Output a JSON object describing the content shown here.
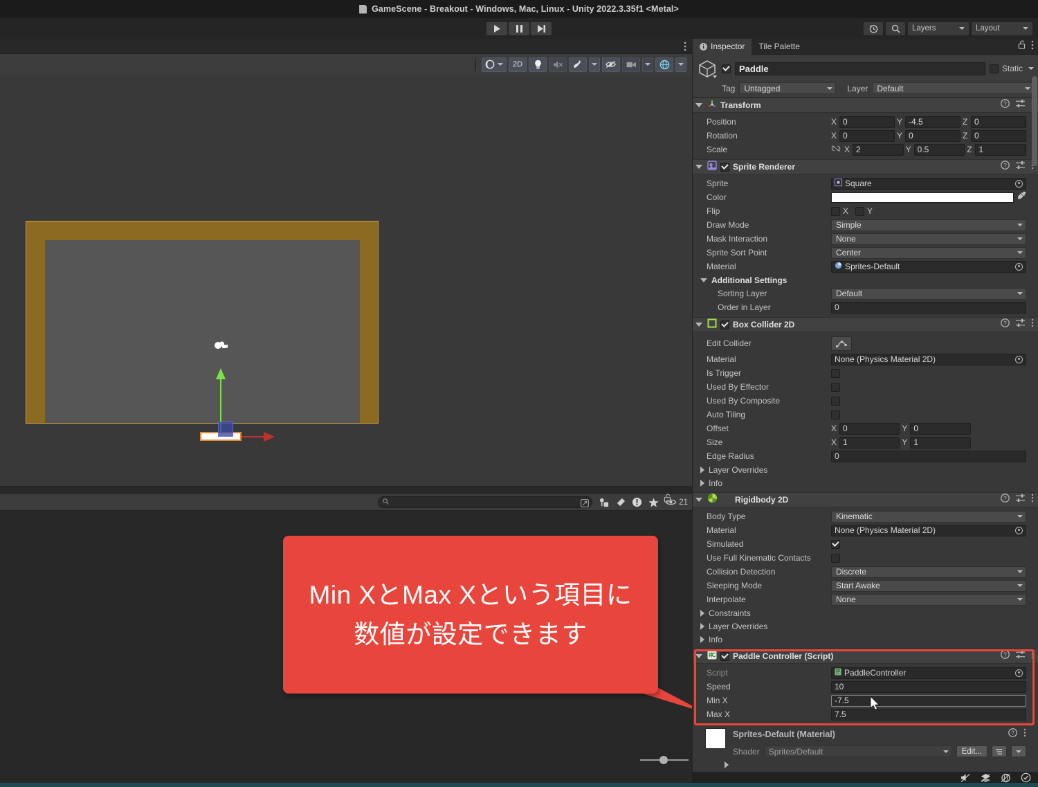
{
  "window": {
    "title": "GameScene - Breakout - Windows, Mac, Linux - Unity 2022.3.35f1 <Metal>",
    "doc_icon": "scene-file-icon"
  },
  "toolbar": {
    "play_icon": "play-icon",
    "pause_icon": "pause-icon",
    "step_icon": "step-icon",
    "history_icon": "undo-history-icon",
    "search_icon": "search-icon",
    "layers_label": "Layers",
    "layout_label": "Layout"
  },
  "scene_toolbar": {
    "buttons": [
      {
        "name": "scene-shading-mode",
        "label": "",
        "icon": "sphere-shading-icon",
        "has_caret": true
      },
      {
        "name": "scene-2d-toggle",
        "label": "2D",
        "icon": "",
        "has_caret": false
      },
      {
        "name": "scene-lighting-toggle",
        "label": "",
        "icon": "lightbulb-icon",
        "has_caret": false
      },
      {
        "name": "scene-audio-toggle",
        "label": "",
        "icon": "speaker-muted-icon",
        "has_caret": false
      },
      {
        "name": "scene-fx-toggle",
        "label": "",
        "icon": "effects-icon",
        "has_caret": true
      },
      {
        "name": "scene-hidden-objects",
        "label": "",
        "icon": "eye-slash-icon",
        "has_caret": false
      },
      {
        "name": "scene-camera-settings",
        "label": "",
        "icon": "camera-icon",
        "has_caret": true
      },
      {
        "name": "scene-gizmos-toggle",
        "label": "",
        "icon": "gizmo-globe-icon",
        "has_caret": true
      }
    ]
  },
  "scene": {
    "play_area_border_color": "#8b6a21",
    "paddle_color": "#ffffff",
    "paddle_outline_color": "#e08a3c",
    "gizmo_y_color": "#7ee04a",
    "gizmo_x_color": "#c0322b",
    "camera_icon": "camera-gizmo-icon"
  },
  "game_panel": {
    "search_placeholder": "",
    "toolbar_icons": [
      {
        "name": "grid-snap-icon"
      },
      {
        "name": "tool-settings-icon"
      },
      {
        "name": "gizmo-eraser-icon"
      },
      {
        "name": "info-icon"
      },
      {
        "name": "favorite-star-icon"
      }
    ],
    "visible_count": "21",
    "lock_icon": "lock-open-icon",
    "kebab_icon": "more-options-icon"
  },
  "callout": {
    "line1": "Min XとMax Xという項目に",
    "line2": "数値が設定できます",
    "background": "#e8453c",
    "text_color": "#ffffff"
  },
  "inspector": {
    "tabs": [
      {
        "label": "Inspector",
        "active": true,
        "icon": "info-icon"
      },
      {
        "label": "Tile Palette",
        "active": false,
        "icon": ""
      }
    ],
    "lock_icon": "lock-open-icon",
    "kebab_icon": "more-options-icon",
    "object": {
      "enabled": true,
      "name": "Paddle",
      "static_label": "Static",
      "static_checked": false,
      "tag_label": "Tag",
      "tag_value": "Untagged",
      "layer_label": "Layer",
      "layer_value": "Default",
      "prefab_icon": "gameobject-cube-icon"
    },
    "components": [
      {
        "id": "transform",
        "title": "Transform",
        "icon": "transform-axis-icon",
        "has_checkbox": false,
        "expanded": true,
        "help_icon": "help-icon",
        "preset_icon": "preset-icon",
        "kebab_icon": "more-options-icon",
        "rows": [
          {
            "type": "vector3",
            "label": "Position",
            "x": "0",
            "y": "-4.5",
            "z": "0",
            "link_icon": null
          },
          {
            "type": "vector3",
            "label": "Rotation",
            "x": "0",
            "y": "0",
            "z": "0",
            "link_icon": null
          },
          {
            "type": "vector3",
            "label": "Scale",
            "x": "2",
            "y": "0.5",
            "z": "1",
            "link_icon": "link-broken-icon"
          }
        ]
      },
      {
        "id": "sprite-renderer",
        "title": "Sprite Renderer",
        "icon": "sprite-renderer-icon",
        "has_checkbox": true,
        "checked": true,
        "expanded": true,
        "rows": [
          {
            "type": "object",
            "label": "Sprite",
            "value": "Square",
            "badge": "sprite-icon"
          },
          {
            "type": "color",
            "label": "Color",
            "value": "#ffffff",
            "picker_icon": "eyedropper-icon"
          },
          {
            "type": "flip",
            "label": "Flip",
            "x_label": "X",
            "y_label": "Y",
            "x_checked": false,
            "y_checked": false
          },
          {
            "type": "dropdown",
            "label": "Draw Mode",
            "value": "Simple"
          },
          {
            "type": "dropdown",
            "label": "Mask Interaction",
            "value": "None"
          },
          {
            "type": "dropdown",
            "label": "Sprite Sort Point",
            "value": "Center"
          },
          {
            "type": "object",
            "label": "Material",
            "value": "Sprites-Default",
            "badge": "material-sphere-icon"
          },
          {
            "type": "subheader",
            "label": "Additional Settings"
          },
          {
            "type": "dropdown",
            "label": "Sorting Layer",
            "value": "Default",
            "indent": true
          },
          {
            "type": "text",
            "label": "Order in Layer",
            "value": "0",
            "indent": true
          }
        ]
      },
      {
        "id": "box-collider-2d",
        "title": "Box Collider 2D",
        "icon": "box-collider-icon",
        "has_checkbox": true,
        "checked": true,
        "expanded": true,
        "rows": [
          {
            "type": "button",
            "label": "Edit Collider",
            "button_icon": "edit-collider-icon"
          },
          {
            "type": "object",
            "label": "Material",
            "value": "None (Physics Material 2D)",
            "badge": null
          },
          {
            "type": "checkbox",
            "label": "Is Trigger",
            "checked": false
          },
          {
            "type": "checkbox",
            "label": "Used By Effector",
            "checked": false
          },
          {
            "type": "checkbox",
            "label": "Used By Composite",
            "checked": false
          },
          {
            "type": "checkbox",
            "label": "Auto Tiling",
            "checked": false
          },
          {
            "type": "vector2",
            "label": "Offset",
            "x": "0",
            "y": "0"
          },
          {
            "type": "vector2",
            "label": "Size",
            "x": "1",
            "y": "1"
          },
          {
            "type": "text",
            "label": "Edge Radius",
            "value": "0"
          },
          {
            "type": "foldout",
            "label": "Layer Overrides"
          },
          {
            "type": "foldout",
            "label": "Info"
          }
        ]
      },
      {
        "id": "rigidbody-2d",
        "title": "Rigidbody 2D",
        "icon": "rigidbody-icon",
        "has_checkbox": false,
        "expanded": true,
        "rows": [
          {
            "type": "dropdown",
            "label": "Body Type",
            "value": "Kinematic"
          },
          {
            "type": "object",
            "label": "Material",
            "value": "None (Physics Material 2D)",
            "badge": null
          },
          {
            "type": "checkbox",
            "label": "Simulated",
            "checked": true
          },
          {
            "type": "checkbox",
            "label": "Use Full Kinematic Contacts",
            "checked": false
          },
          {
            "type": "dropdown",
            "label": "Collision Detection",
            "value": "Discrete"
          },
          {
            "type": "dropdown",
            "label": "Sleeping Mode",
            "value": "Start Awake"
          },
          {
            "type": "dropdown",
            "label": "Interpolate",
            "value": "None"
          },
          {
            "type": "foldout",
            "label": "Constraints"
          },
          {
            "type": "foldout",
            "label": "Layer Overrides"
          },
          {
            "type": "foldout",
            "label": "Info"
          }
        ]
      },
      {
        "id": "paddle-controller",
        "title": "Paddle Controller (Script)",
        "icon": "csharp-script-icon",
        "has_checkbox": true,
        "checked": true,
        "expanded": true,
        "highlighted": true,
        "rows": [
          {
            "type": "object",
            "label": "Script",
            "value": "PaddleController",
            "badge": "script-asset-icon",
            "readonly": true
          },
          {
            "type": "text",
            "label": "Speed",
            "value": "10"
          },
          {
            "type": "text",
            "label": "Min X",
            "value": "-7.5",
            "focused": true
          },
          {
            "type": "text",
            "label": "Max X",
            "value": "7.5"
          }
        ]
      }
    ],
    "material_preview": {
      "title": "Sprites-Default (Material)",
      "shader_label": "Shader",
      "shader_value": "Sprites/Default",
      "edit_label": "Edit...",
      "help_icon": "help-icon",
      "kebab_icon": "more-options-icon",
      "menu_icon": "shader-menu-icon"
    }
  },
  "statusbar": {
    "icons": [
      {
        "name": "mute-audio-icon"
      },
      {
        "name": "layers-status-icon"
      },
      {
        "name": "gizmos-status-icon"
      },
      {
        "name": "ready-check-icon"
      }
    ]
  }
}
